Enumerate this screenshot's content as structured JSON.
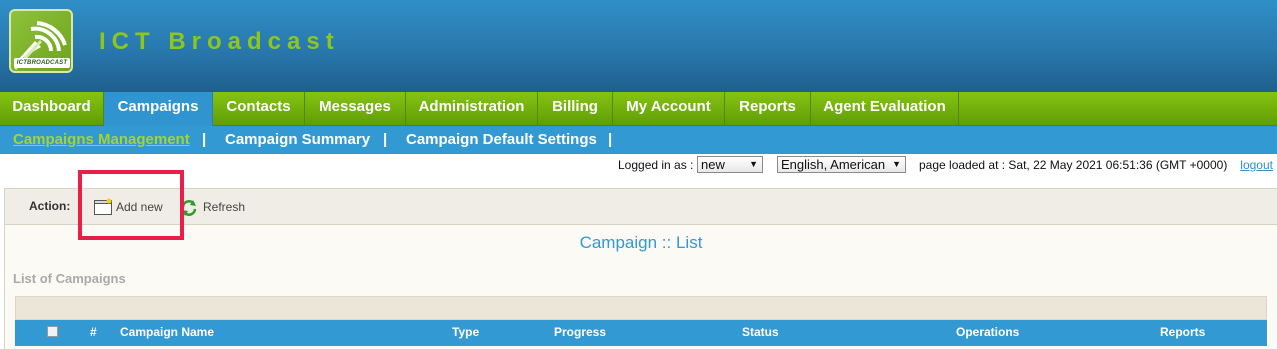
{
  "header": {
    "brand": "ICT Broadcast",
    "logo_text": "ICTBROADCAST"
  },
  "main_nav": [
    {
      "label": "Dashboard"
    },
    {
      "label": "Campaigns",
      "active": true
    },
    {
      "label": "Contacts"
    },
    {
      "label": "Messages"
    },
    {
      "label": "Administration"
    },
    {
      "label": "Billing"
    },
    {
      "label": "My Account"
    },
    {
      "label": "Reports"
    },
    {
      "label": "Agent Evaluation"
    }
  ],
  "sub_nav": [
    {
      "label": "Campaigns Management",
      "active": true
    },
    {
      "label": "Campaign Summary"
    },
    {
      "label": "Campaign Default Settings"
    }
  ],
  "sub_nav_separator": "|",
  "status": {
    "logged_in_label": "Logged in as :",
    "user_select": "new",
    "language_select": "English, American",
    "page_loaded": "page loaded at : Sat, 22 May 2021 06:51:36 (GMT +0000)",
    "logout": "logout"
  },
  "actions": {
    "label": "Action:",
    "add_new": "Add new",
    "refresh": "Refresh"
  },
  "page_title": "Campaign :: List",
  "list_label": "List of Campaigns",
  "table": {
    "columns": [
      "#",
      "Campaign Name",
      "Type",
      "Progress",
      "Status",
      "Operations",
      "Reports"
    ]
  },
  "colors": {
    "header_blue": "#2878ad",
    "nav_green": "#6aab0a",
    "active_blue": "#3399d3",
    "brand_green": "#8ec61c",
    "highlight_red": "#e81f48"
  }
}
